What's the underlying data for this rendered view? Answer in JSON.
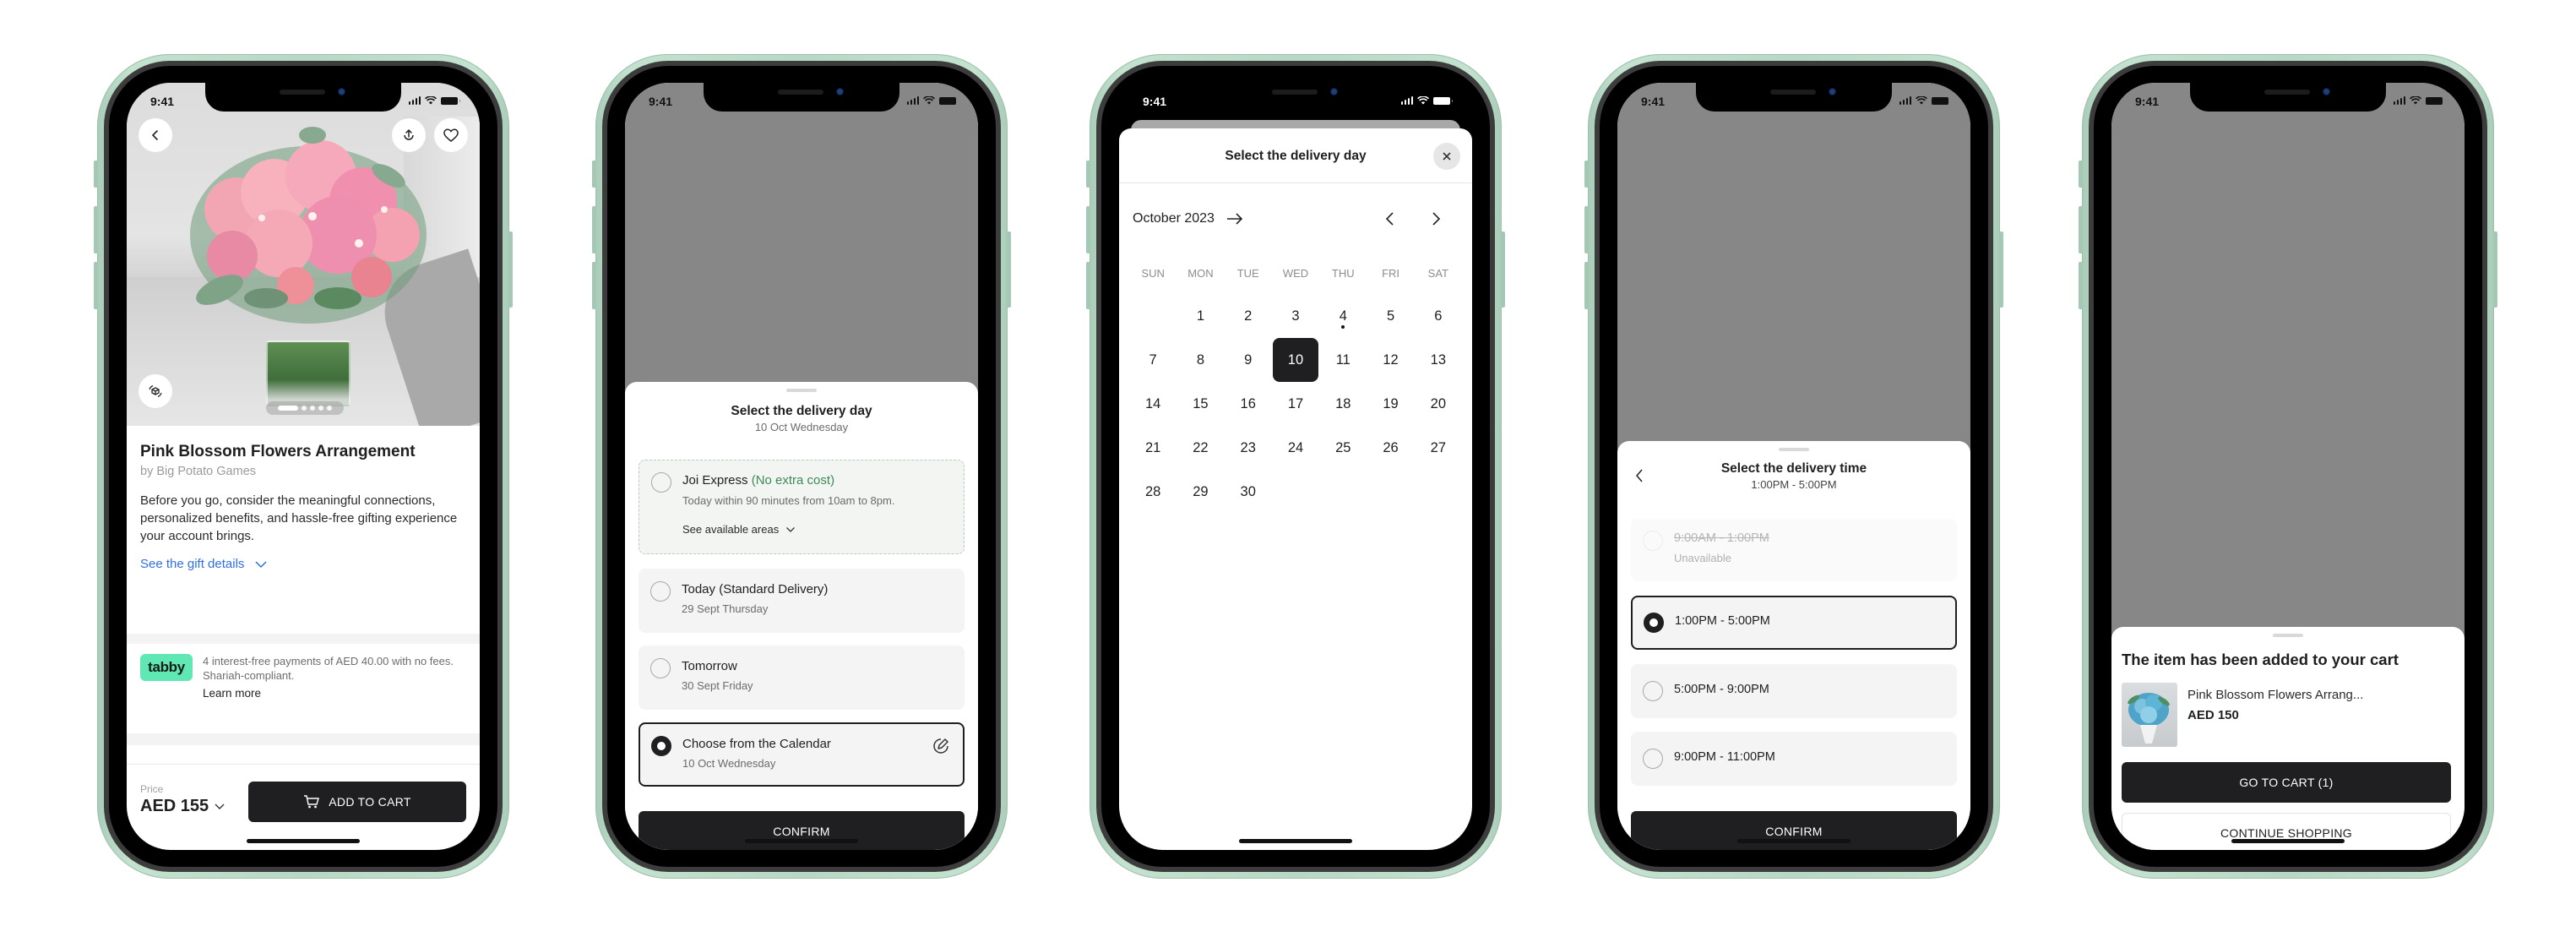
{
  "status_bar": {
    "time": "9:41"
  },
  "product_screen": {
    "title": "Pink Blossom Flowers Arrangement",
    "brand": "by Big Potato Games",
    "description": "Before you go, consider the meaningful connections, personalized benefits, and hassle-free gifting experience your account brings.",
    "gift_details_link": "See the gift details",
    "carousel": {
      "total_images": 5,
      "active_index": 1
    },
    "tabby": {
      "logo": "tabby",
      "text": "4 interest-free payments of AED 40.00 with no fees. Shariah-compliant.",
      "learn_more": "Learn more"
    },
    "price_label": "Price",
    "price": "AED 155",
    "add_to_cart": "ADD TO CART",
    "icons": [
      "back-icon",
      "share-icon",
      "heart-icon",
      "ar-view-icon",
      "cart-icon",
      "chevron-down-icon"
    ]
  },
  "delivery_day_sheet": {
    "title": "Select the delivery day",
    "subtitle": "10 Oct Wednesday",
    "options": [
      {
        "title": "Joi Express",
        "badge": "(No extra cost)",
        "subtitle": "Today within 90 minutes from 10am to 8pm.",
        "link": "See available areas",
        "selected": false
      },
      {
        "title": "Today (Standard Delivery)",
        "subtitle": "29 Sept Thursday",
        "selected": false
      },
      {
        "title": "Tomorrow",
        "subtitle": "30 Sept Friday",
        "selected": false
      },
      {
        "title": "Choose from the Calendar",
        "subtitle": "10 Oct Wednesday",
        "selected": true
      }
    ],
    "confirm": "CONFIRM"
  },
  "calendar_sheet": {
    "title": "Select the delivery day",
    "month": "October 2023",
    "weekdays": [
      "SUN",
      "MON",
      "TUE",
      "WED",
      "THU",
      "FRI",
      "SAT"
    ],
    "first_weekday_index": 1,
    "days_in_month": 30,
    "selected_day": 10,
    "marked_day": 4
  },
  "delivery_time_sheet": {
    "title": "Select the delivery time",
    "subtitle": "1:00PM - 5:00PM",
    "slots": [
      {
        "label": "9:00AM - 1:00PM",
        "note": "Unavailable",
        "available": false,
        "selected": false
      },
      {
        "label": "1:00PM - 5:00PM",
        "available": true,
        "selected": true
      },
      {
        "label": "5:00PM - 9:00PM",
        "available": true,
        "selected": false
      },
      {
        "label": "9:00PM - 11:00PM",
        "available": true,
        "selected": false
      }
    ],
    "confirm": "CONFIRM"
  },
  "cart_added_sheet": {
    "title": "The item has been added to your cart",
    "item_name": "Pink Blossom Flowers Arrang...",
    "item_price": "AED 150",
    "go_to_cart": "GO TO CART (1)",
    "continue_shopping": "CONTINUE SHOPPING"
  },
  "colors": {
    "frame": "#b7d8c4",
    "primary_dark": "#1f1f22",
    "link_blue": "#2f6fe6",
    "express_green": "#3c8a56",
    "tabby_green": "#5fe7b4",
    "overlay_grey": "#878787"
  }
}
